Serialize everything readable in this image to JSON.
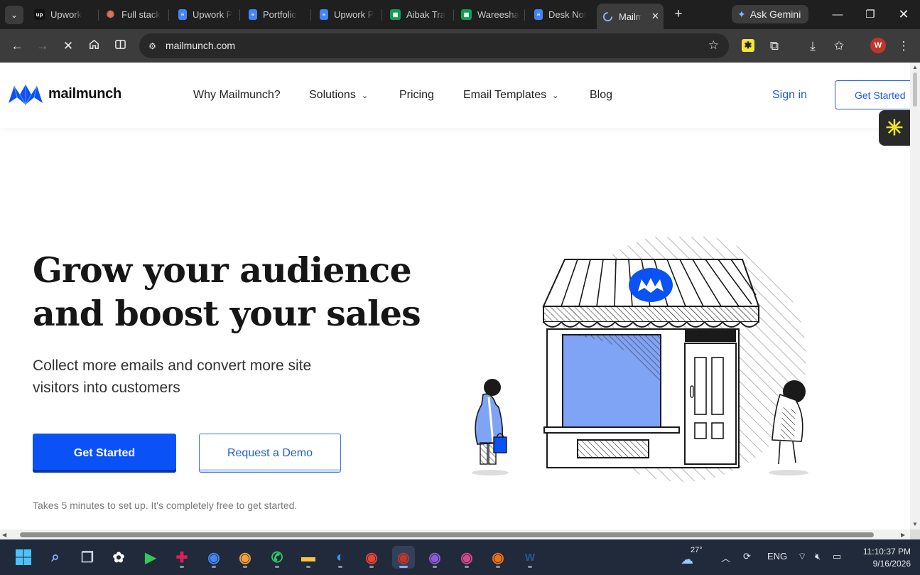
{
  "browser": {
    "tabs": [
      {
        "label": "Upwork",
        "icon": "upwork-icon",
        "color": "#111111"
      },
      {
        "label": "Full stack",
        "icon": "claude-icon",
        "color": "#d97757"
      },
      {
        "label": "Upwork P",
        "icon": "google-docs-icon",
        "color": "#4285f4"
      },
      {
        "label": "Portfolio",
        "icon": "google-docs-icon",
        "color": "#4285f4"
      },
      {
        "label": "Upwork P",
        "icon": "google-docs-icon",
        "color": "#4285f4"
      },
      {
        "label": "Aibak Tra",
        "icon": "google-sheets-icon",
        "color": "#0f9d58"
      },
      {
        "label": "Wareesha",
        "icon": "google-sheets-icon",
        "color": "#0f9d58"
      },
      {
        "label": "Desk Not",
        "icon": "google-docs-icon",
        "color": "#4285f4"
      }
    ],
    "active_tab": {
      "label": "Mailm",
      "icon": "loading-spinner-icon"
    },
    "gemini_label": "Ask Gemini",
    "url": "mailmunch.com",
    "profile_initial": "W"
  },
  "site": {
    "logo_text": "mailmunch",
    "brand_color": "#0a52f5",
    "nav": {
      "why": "Why Mailmunch?",
      "solutions": "Solutions",
      "pricing": "Pricing",
      "templates": "Email Templates",
      "blog": "Blog",
      "signin": "Sign in",
      "cta": "Get Started"
    },
    "hero": {
      "title_line1": "Grow your audience",
      "title_line2": "and boost your sales",
      "subtitle_line1": "Collect more emails and convert more site",
      "subtitle_line2": "visitors into customers",
      "primary_button": "Get Started",
      "secondary_button": "Request a Demo",
      "note": "Takes 5 minutes to set up. It's completely free to get started."
    }
  },
  "taskbar": {
    "apps": [
      {
        "name": "search-icon",
        "color": "#7fb2ff"
      },
      {
        "name": "task-view-icon",
        "color": "#cfd6e4"
      },
      {
        "name": "chatgpt-icon",
        "color": "#ffffff"
      },
      {
        "name": "media-player-icon",
        "color": "#34c759"
      },
      {
        "name": "slack-icon",
        "color": "#e01e5a"
      },
      {
        "name": "chrome-icon",
        "color": "#4285f4"
      },
      {
        "name": "chrome-profile-icon",
        "color": "#f4a13a"
      },
      {
        "name": "whatsapp-icon",
        "color": "#25d366"
      },
      {
        "name": "file-explorer-icon",
        "color": "#f6c343"
      },
      {
        "name": "edge-icon",
        "color": "#2b9be6"
      },
      {
        "name": "chrome-profile-icon",
        "color": "#ea4335"
      },
      {
        "name": "chrome-profile-icon",
        "color": "#c0362c"
      },
      {
        "name": "chrome-profile-icon",
        "color": "#8e5ad6"
      },
      {
        "name": "chrome-profile-icon",
        "color": "#d04a8a"
      },
      {
        "name": "chrome-profile-icon",
        "color": "#e8711a"
      },
      {
        "name": "word-icon",
        "color": "#2b579a"
      }
    ],
    "temperature": "27°",
    "language": "ENG",
    "time": "11:10:37 PM",
    "date": "9/16/2026"
  }
}
